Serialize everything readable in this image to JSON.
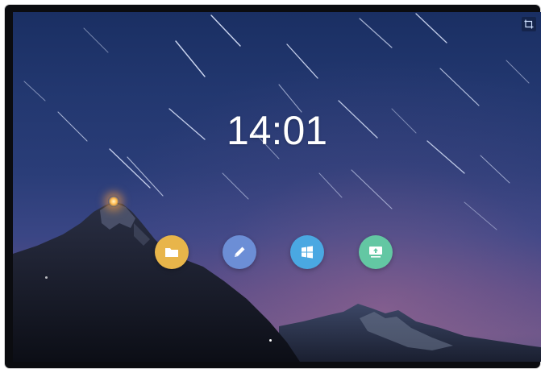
{
  "home_screen": {
    "time": "14:01"
  },
  "colors": {
    "files_app": "#e8b54a",
    "notes_app": "#6c8ed6",
    "windows_app": "#4aa8e2",
    "cast_app": "#63c7a3"
  },
  "apps": [
    {
      "icon": "folder-icon",
      "color_key": "files_app"
    },
    {
      "icon": "pencil-icon",
      "color_key": "notes_app"
    },
    {
      "icon": "windows-logo-icon",
      "color_key": "windows_app"
    },
    {
      "icon": "screen-share-icon",
      "color_key": "cast_app"
    }
  ],
  "corner_control": {
    "icon": "screenshot-icon"
  }
}
